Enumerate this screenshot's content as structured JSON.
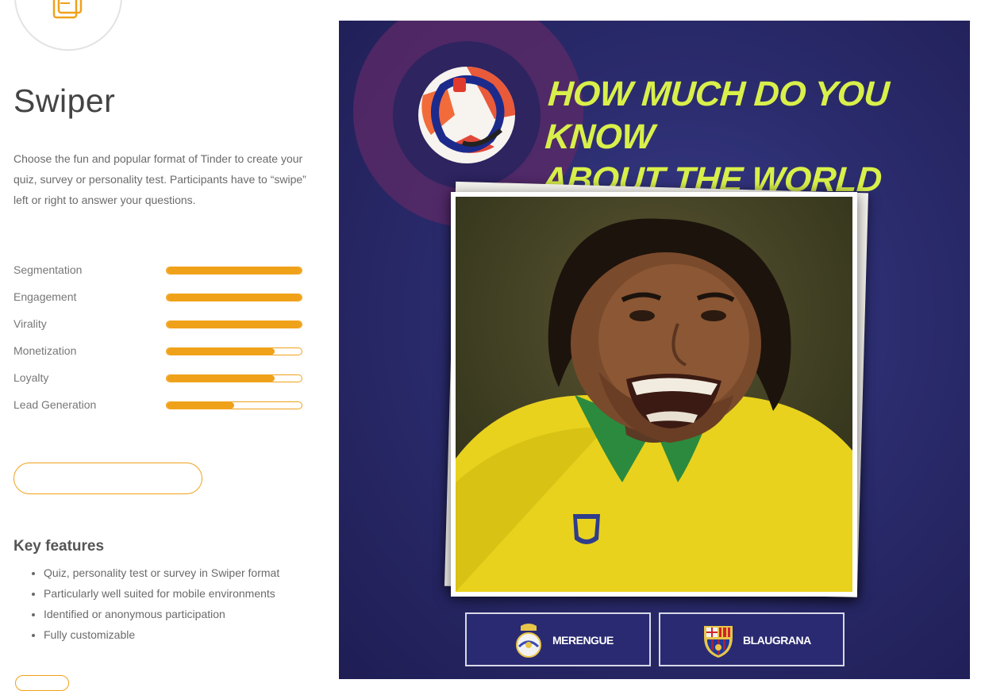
{
  "quiz_type": {
    "title": "Swiper",
    "description": "Choose the fun and popular format of Tinder to create your quiz, survey or personality test. Participants have to “swipe” left or right to answer your questions."
  },
  "metrics": [
    {
      "label": "Segmentation",
      "fill": 1.0
    },
    {
      "label": "Engagement",
      "fill": 1.0
    },
    {
      "label": "Virality",
      "fill": 1.0
    },
    {
      "label": "Monetization",
      "fill": 0.8
    },
    {
      "label": "Loyalty",
      "fill": 0.8
    },
    {
      "label": "Lead Generation",
      "fill": 0.5
    }
  ],
  "features": {
    "title": "Key features",
    "items": [
      "Quiz, personality test or survey in Swiper format",
      "Particularly well suited for mobile environments",
      "Identified or anonymous participation",
      "Fully customizable"
    ]
  },
  "preview": {
    "headline_line1": "HOW MUCH DO YOU KNOW",
    "headline_line2": "ABOUT THE WORLD CUP?",
    "answers": [
      {
        "label": "MERENGUE",
        "icon": "real-madrid-crest-icon"
      },
      {
        "label": "BLAUGRANA",
        "icon": "fc-barcelona-crest-icon"
      }
    ]
  },
  "colors": {
    "accent": "#f0a11a",
    "preview_bg": "#2b2c6e",
    "headline": "#d9f04a"
  }
}
